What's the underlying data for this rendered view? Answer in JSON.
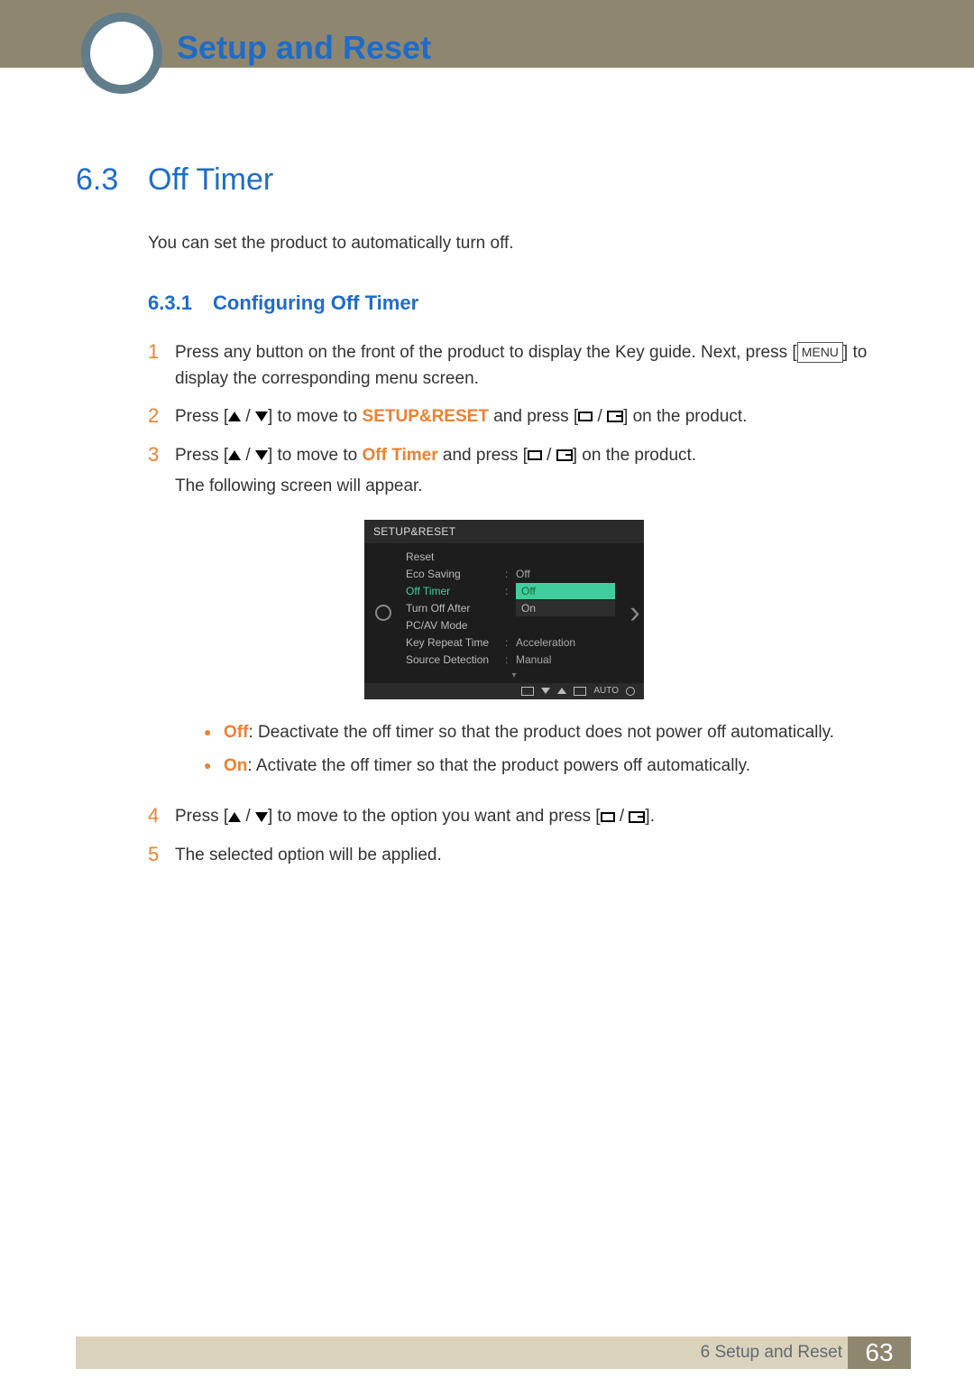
{
  "header": {
    "chapter_title": "Setup and Reset"
  },
  "section": {
    "number": "6.3",
    "title": "Off Timer"
  },
  "lead": "You can set the product to automatically turn off.",
  "subsection": {
    "number": "6.3.1",
    "title": "Configuring Off Timer"
  },
  "steps": {
    "s1_a": "Press any button on the front of the product to display the Key guide. Next, press [",
    "s1_menu": "MENU",
    "s1_b": "] to display the corresponding menu screen.",
    "s2_a": "Press [",
    "s2_b": "] to move to ",
    "s2_hl": "SETUP&RESET",
    "s2_c": " and press [",
    "s2_d": "] on the product.",
    "s3_a": "Press [",
    "s3_b": "] to move to ",
    "s3_hl": "Off Timer",
    "s3_c": " and press [",
    "s3_d": "] on the product.",
    "s3_after": "The following screen will appear.",
    "bul_off_label": "Off",
    "bul_off_text": ": Deactivate the off timer so that the product does not power off automatically.",
    "bul_on_label": "On",
    "bul_on_text": ": Activate the off timer so that the product powers off automatically.",
    "s4_a": "Press [",
    "s4_b": "] to move to the option you want and press [",
    "s4_c": "].",
    "s5": "The selected option will be applied."
  },
  "step_numbers": {
    "n1": "1",
    "n2": "2",
    "n3": "3",
    "n4": "4",
    "n5": "5"
  },
  "osd": {
    "title": "SETUP&RESET",
    "rows": {
      "reset": "Reset",
      "eco": "Eco Saving",
      "eco_v": "Off",
      "offtimer": "Off Timer",
      "opt_off": "Off",
      "opt_on": "On",
      "turnoff": "Turn Off After",
      "pcav": "PC/AV Mode",
      "krt": "Key Repeat Time",
      "krt_v": "Acceleration",
      "srcdet": "Source Detection",
      "srcdet_v": "Manual"
    },
    "ft_auto": "AUTO"
  },
  "footer": {
    "chapter": "6 Setup and Reset",
    "page": "63"
  }
}
